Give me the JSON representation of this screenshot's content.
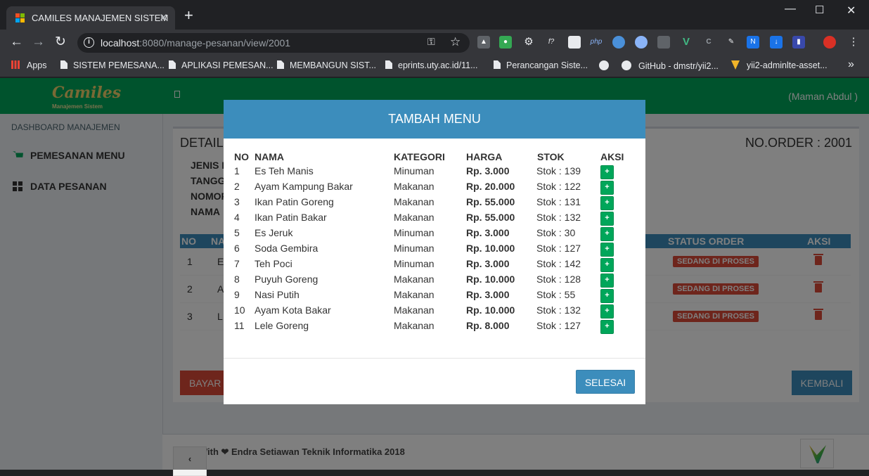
{
  "browser": {
    "tab_title": "CAMILES MANAJEMEN SISTEM",
    "tab_close": "✕",
    "new_tab": "+",
    "url_host": "localhost",
    "url_rest": ":8080/manage-pesanan/view/2001",
    "info_icon": "i",
    "bookmarks": [
      "Apps",
      "SISTEM PEMESANA...",
      "APLIKASI PEMESAN...",
      "MEMBANGUN SIST...",
      "eprints.uty.ac.id/11...",
      "Perancangan Siste...",
      "GitHub - dmstr/yii2...",
      "yii2-adminlte-asset..."
    ],
    "more": "»"
  },
  "app": {
    "logo": "Camiles",
    "logo_sub": "Manajemen Sistem",
    "user": "(Maman Abdul )",
    "sidebar": {
      "header": "DASHBOARD MANAJEMEN",
      "items": [
        "PEMESANAN MENU",
        "DATA PESANAN"
      ]
    },
    "detail": {
      "title": "DETAIL",
      "order_no": "NO.ORDER : 2001",
      "info_labels": [
        "JENIS I",
        "TANGG",
        "NOMOR",
        "NAMA"
      ]
    },
    "table": {
      "headers": [
        "NO",
        "NA",
        "STATUS ORDER",
        "AKSI"
      ],
      "rows": [
        {
          "no": "1",
          "name": "E",
          "status": "SEDANG DI PROSES"
        },
        {
          "no": "2",
          "name": "A",
          "status": "SEDANG DI PROSES"
        },
        {
          "no": "3",
          "name": "L",
          "status": "SEDANG DI PROSES"
        }
      ]
    },
    "buttons": {
      "bayar": "BAYAR",
      "kembali": "KEMBALI"
    },
    "footer": "Made With ❤ Endra Setiawan Teknik Informatika 2018",
    "pager_prev": "‹"
  },
  "modal": {
    "title": "TAMBAH MENU",
    "headers": [
      "NO",
      "NAMA",
      "KATEGORI",
      "HARGA",
      "STOK",
      "AKSI"
    ],
    "add_label": "+",
    "items": [
      {
        "no": "1",
        "nama": "Es Teh Manis",
        "kategori": "Minuman",
        "harga": "Rp. 3.000",
        "stok": "Stok : 139"
      },
      {
        "no": "2",
        "nama": "Ayam Kampung Bakar",
        "kategori": "Makanan",
        "harga": "Rp. 20.000",
        "stok": "Stok : 122"
      },
      {
        "no": "3",
        "nama": "Ikan Patin Goreng",
        "kategori": "Makanan",
        "harga": "Rp. 55.000",
        "stok": "Stok : 131"
      },
      {
        "no": "4",
        "nama": "Ikan Patin Bakar",
        "kategori": "Makanan",
        "harga": "Rp. 55.000",
        "stok": "Stok : 132"
      },
      {
        "no": "5",
        "nama": "Es Jeruk",
        "kategori": "Minuman",
        "harga": "Rp. 3.000",
        "stok": "Stok : 30"
      },
      {
        "no": "6",
        "nama": "Soda Gembira",
        "kategori": "Minuman",
        "harga": "Rp. 10.000",
        "stok": "Stok : 127"
      },
      {
        "no": "7",
        "nama": "Teh Poci",
        "kategori": "Minuman",
        "harga": "Rp. 3.000",
        "stok": "Stok : 142"
      },
      {
        "no": "8",
        "nama": "Puyuh Goreng",
        "kategori": "Makanan",
        "harga": "Rp. 10.000",
        "stok": "Stok : 128"
      },
      {
        "no": "9",
        "nama": "Nasi Putih",
        "kategori": "Makanan",
        "harga": "Rp. 3.000",
        "stok": "Stok : 55"
      },
      {
        "no": "10",
        "nama": "Ayam Kota Bakar",
        "kategori": "Makanan",
        "harga": "Rp. 10.000",
        "stok": "Stok : 132"
      },
      {
        "no": "11",
        "nama": "Lele Goreng",
        "kategori": "Makanan",
        "harga": "Rp. 8.000",
        "stok": "Stok : 127"
      }
    ],
    "done_button": "SELESAI"
  },
  "colors": {
    "header_green": "#00a65a",
    "primary_blue": "#3c8dbc",
    "danger_red": "#dd4b39"
  }
}
